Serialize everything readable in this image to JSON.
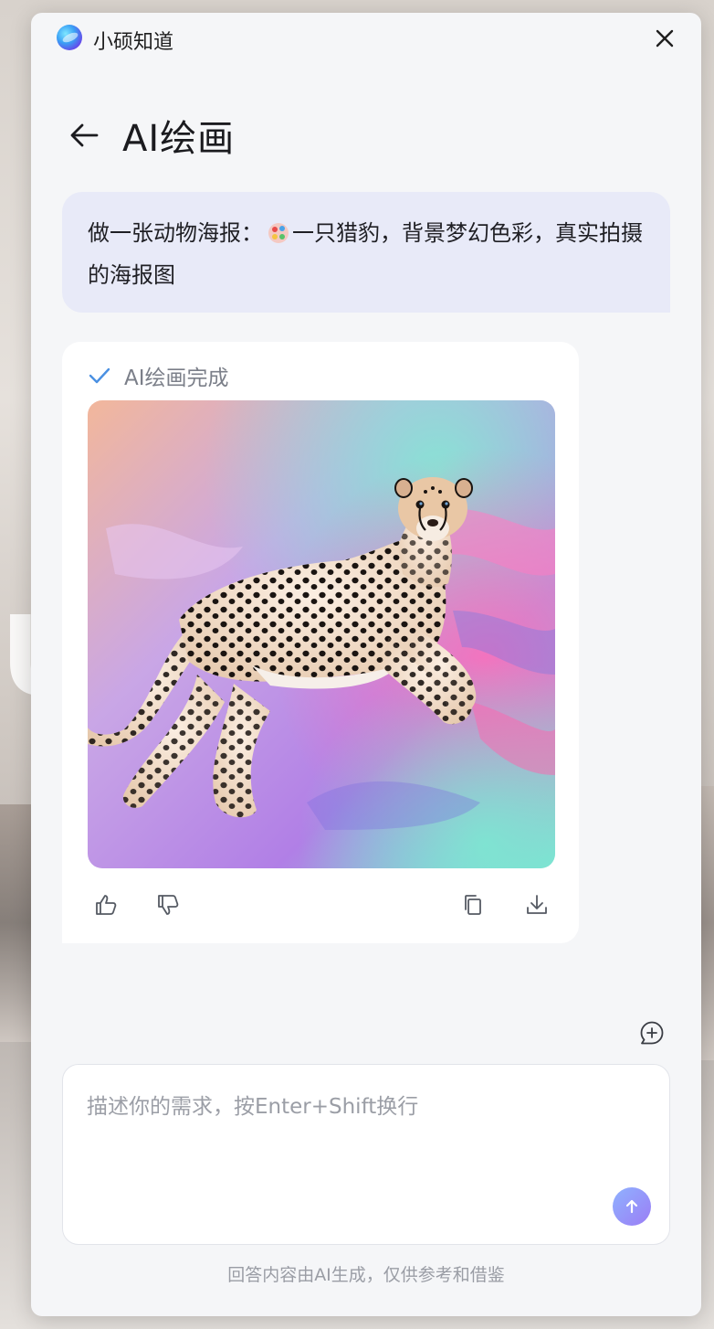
{
  "app": {
    "title": "小硕知道"
  },
  "header": {
    "title": "AI绘画"
  },
  "user_message": {
    "text_before": "做一张动物海报：",
    "text_after": "一只猎豹，背景梦幻色彩，真实拍摄的海报图"
  },
  "ai_response": {
    "status": "AI绘画完成",
    "image_subject": "cheetah on dreamy pastel background"
  },
  "input": {
    "placeholder": "描述你的需求，按Enter+Shift换行",
    "value": ""
  },
  "footer": {
    "disclaimer": "回答内容由AI生成，仅供参考和借鉴"
  },
  "colors": {
    "accent": "#8f9ef8",
    "user_bubble": "#e8eaf8",
    "check": "#4a90e2",
    "window_bg": "#f5f6f8"
  },
  "icons": [
    "close-icon",
    "back-arrow-icon",
    "check-icon",
    "thumbs-up-icon",
    "thumbs-down-icon",
    "copy-icon",
    "download-icon",
    "new-chat-icon",
    "send-arrow-icon",
    "palette-emoji-icon"
  ]
}
